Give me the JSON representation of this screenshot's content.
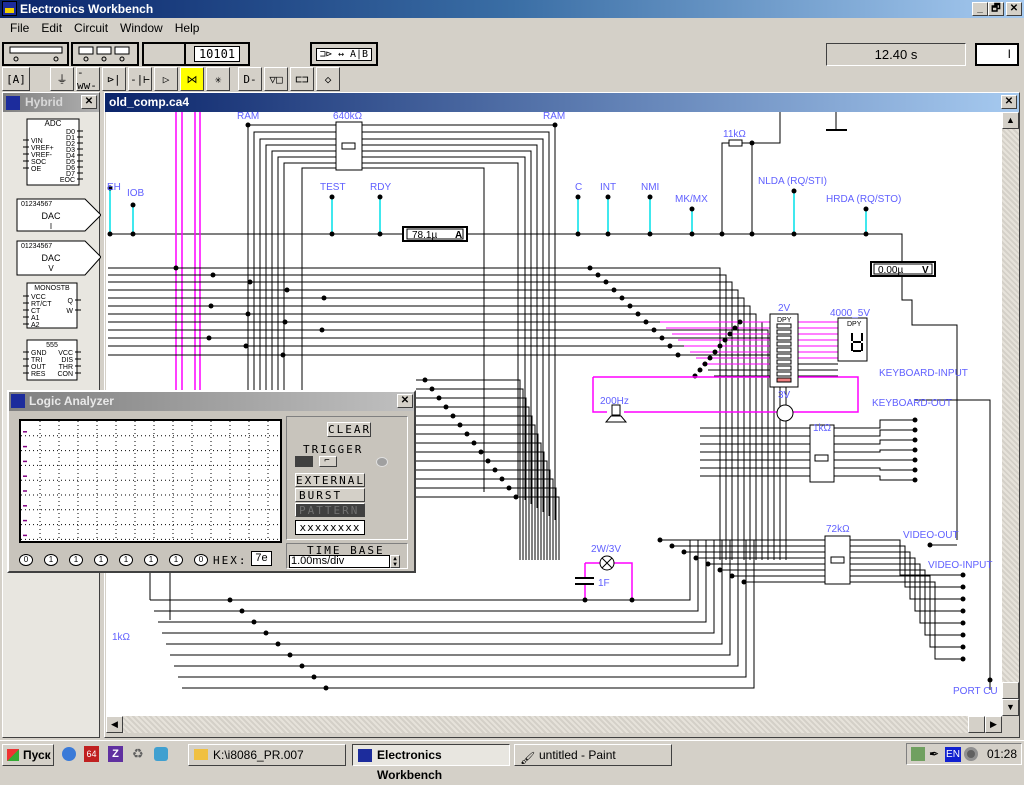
{
  "app": {
    "title": "Electronics Workbench",
    "window_buttons": [
      "_",
      "🗗",
      "✕"
    ]
  },
  "menu": [
    "File",
    "Edit",
    "Circuit",
    "Window",
    "Help"
  ],
  "toolbar": {
    "instruments": [
      "multimeter",
      "function-generator",
      "oscilloscope",
      "word-generator",
      "logic-analyzer"
    ],
    "word_gen_label": "10101",
    "logic_conv_label": "A|B",
    "parts_bins": [
      "favorites",
      "sources",
      "basic",
      "diodes",
      "transistors",
      "analog-ics",
      "mixed-ics",
      "digital-ics",
      "logic-gates",
      "digital",
      "indicators",
      "controls",
      "misc"
    ],
    "selected_bin": "mixed-ics",
    "timer": "12.40 s",
    "power_label": "I"
  },
  "parts_bin": {
    "title": "Hybrid",
    "adc": {
      "title": "ADC",
      "left_pins": [
        "VIN",
        "VREF+",
        "VREF-",
        "SOC",
        "OE"
      ],
      "right_pins": [
        "D0",
        "D1",
        "D2",
        "D3",
        "D4",
        "D5",
        "D6",
        "D7",
        "EOC"
      ]
    },
    "dac_i": {
      "bits": "01234567",
      "title": "DAC",
      "sub": "I"
    },
    "dac_v": {
      "bits": "01234567",
      "title": "DAC",
      "sub": "V"
    },
    "monostable": {
      "title": "MONOSTB",
      "left_pins": [
        "VCC",
        "RT/CT",
        "CT",
        "A1",
        "A2"
      ],
      "right_pins": [
        "Q",
        "W"
      ]
    },
    "timer555": {
      "title": "555",
      "left_pins": [
        "GND",
        "TRI",
        "OUT",
        "RES"
      ],
      "right_pins": [
        "VCC",
        "DIS",
        "THR",
        "CON"
      ]
    }
  },
  "circuit": {
    "title": "old_comp.ca4",
    "labels": {
      "ram_left": "RAM",
      "res_640k": "640kΩ",
      "ram_right": "RAM",
      "eh": "EH",
      "iob": "IOB",
      "test": "TEST",
      "rdy": "RDY",
      "c": "C",
      "int": "INT",
      "nmi": "NMI",
      "mkmx": "MK/MX",
      "res_11k": "11kΩ",
      "nlda": "NLDA (RQ/STI)",
      "hrda": "HRDA (RQ/STO)",
      "bar_2v": "2V",
      "dpy_4000": "4000_5V",
      "kb_in": "KEYBOARD-INPUT",
      "kb_out": "KEYBOARD-OUT",
      "buzzer": "200Hz",
      "src_3v": "3V",
      "res_1k": "1kΩ",
      "res_1k_left": "1kΩ",
      "lamp": "2W/3V",
      "cap": "1F",
      "res_72k": "72kΩ",
      "video_out": "VIDEO-OUT",
      "video_in": "VIDEO-INPUT",
      "port": "PORT CU"
    },
    "ammeter": {
      "value": "78.1µ",
      "unit": "A"
    },
    "voltmeter": {
      "value": "0.00µ",
      "unit": "V"
    },
    "dpy_text": "DPY",
    "colors": {
      "wire": "#000000",
      "pin": "#00e0e8",
      "bus": "#ff00ff",
      "label": "#6060ff"
    }
  },
  "logic_analyzer": {
    "title": "Logic Analyzer",
    "clear": "CLEAR",
    "trigger": "TRIGGER",
    "external": "EXTERNAL",
    "burst": "BURST",
    "pattern": "PATTERN",
    "pattern_value": "xxxxxxxx",
    "time_base_label": "TIME BASE",
    "time_base": "1.00ms/div",
    "bits": [
      "0",
      "1",
      "1",
      "1",
      "1",
      "1",
      "1",
      "0"
    ],
    "hex_label": "HEX:",
    "hex": "7e"
  },
  "taskbar": {
    "start": "Пуск",
    "tasks": [
      "K:\\i8086_PR.007",
      "Electronics Workbench",
      "untitled - Paint"
    ],
    "active_task": 1,
    "lang": "EN",
    "clock": "01:28"
  }
}
